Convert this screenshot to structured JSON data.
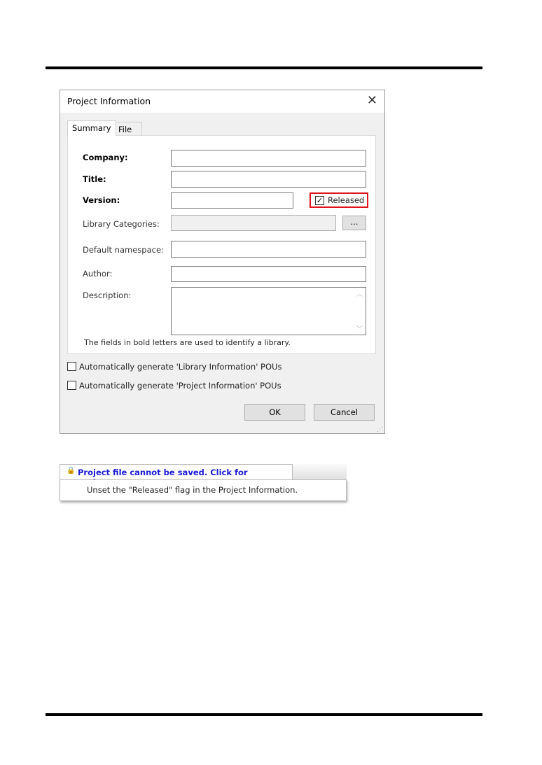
{
  "dialog": {
    "title": "Project Information",
    "tabs": [
      "Summary",
      "File"
    ],
    "fields": {
      "company": "Company:",
      "title": "Title:",
      "version": "Version:",
      "library_categories": "Library Categories:",
      "default_namespace": "Default namespace:",
      "author": "Author:",
      "description": "Description:"
    },
    "released": {
      "label": "Released",
      "checked": true,
      "highlight_color": "#e0121b"
    },
    "browse_label": "...",
    "note": "The fields in bold letters are used to identify a library.",
    "options": [
      {
        "label": "Automatically generate 'Library Information' POUs",
        "checked": false
      },
      {
        "label": "Automatically generate 'Project Information' POUs",
        "checked": false
      }
    ],
    "ok": "OK",
    "cancel": "Cancel"
  },
  "notification": {
    "title": "Project file cannot be saved. Click for options...",
    "option": "Unset the \"Released\" flag in the Project Information.",
    "icon": "lock-icon",
    "title_color": "#1a1ad6"
  }
}
